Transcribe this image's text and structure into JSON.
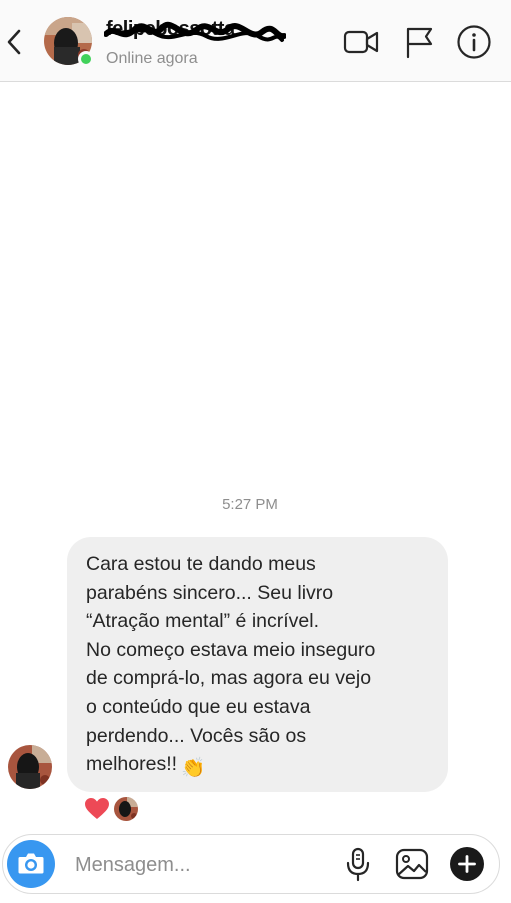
{
  "header": {
    "username": "felipebossotta",
    "status": "Online agora",
    "icons": [
      "back-arrow-icon",
      "video-call-icon",
      "flag-icon",
      "info-icon"
    ],
    "online_color": "#41d15a"
  },
  "conversation": {
    "timestamp": "5:27 PM",
    "message": {
      "lines": [
        "Cara estou te dando meus",
        "parabéns sincero... Seu livro",
        "“Atração mental” é incrível.",
        "No começo estava meio inseguro",
        "de comprá-lo, mas agora eu vejo",
        "o conteúdo que eu estava",
        "perdendo... Vocês são os",
        "melhores!!"
      ],
      "emoji": "👏",
      "bubble_color": "#efefef"
    },
    "reactions": [
      "❤️"
    ]
  },
  "composer": {
    "placeholder": "Mensagem...",
    "icons": [
      "camera-icon",
      "microphone-icon",
      "gallery-icon",
      "plus-icon"
    ],
    "accent": "#3897f0"
  }
}
